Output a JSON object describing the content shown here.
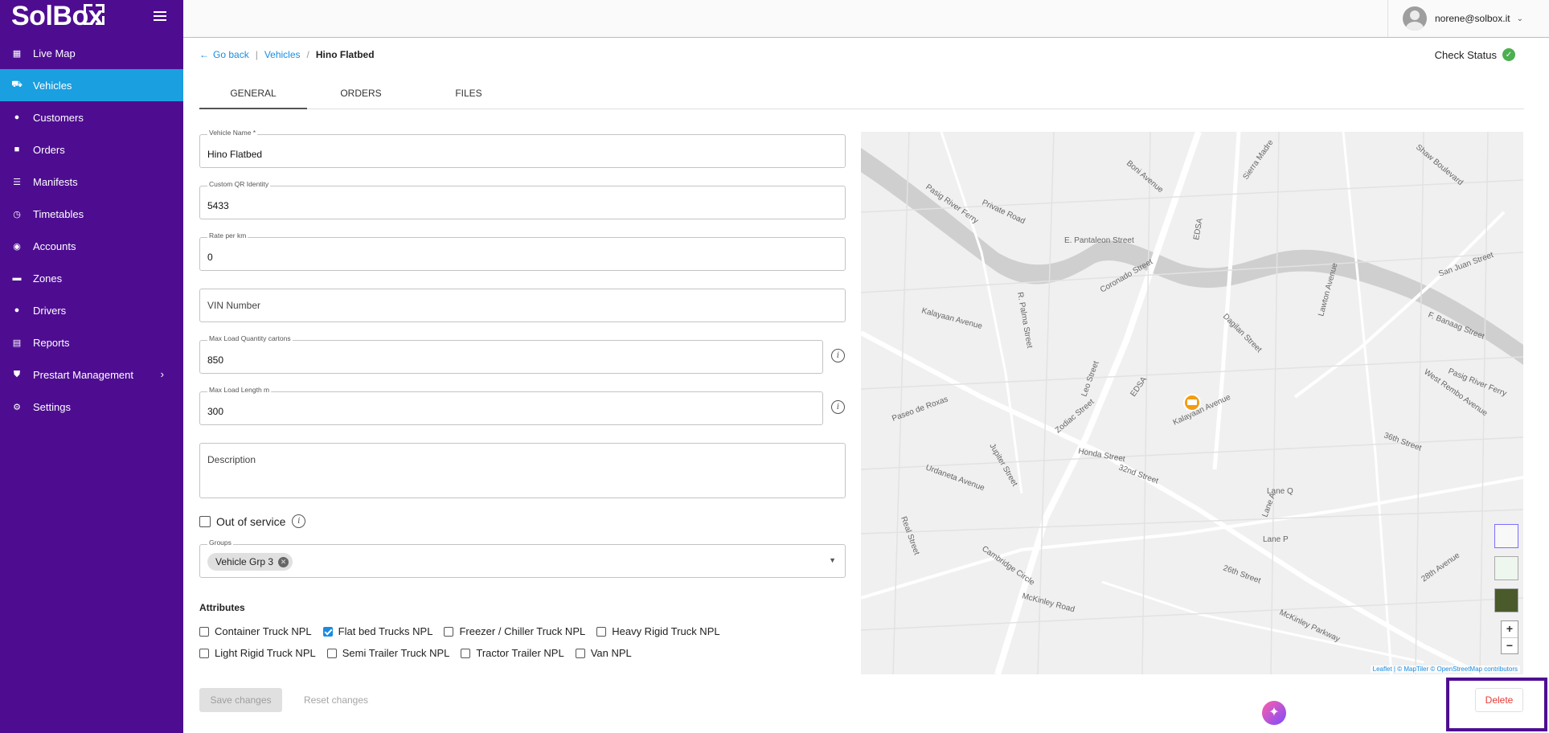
{
  "app": {
    "logo": "SolBox"
  },
  "sidebar": {
    "items": [
      {
        "label": "Live Map",
        "icon": "dashboard-icon"
      },
      {
        "label": "Vehicles",
        "icon": "truck-icon"
      },
      {
        "label": "Customers",
        "icon": "person-icon"
      },
      {
        "label": "Orders",
        "icon": "folder-icon"
      },
      {
        "label": "Manifests",
        "icon": "list-icon"
      },
      {
        "label": "Timetables",
        "icon": "clock-icon"
      },
      {
        "label": "Accounts",
        "icon": "account-icon"
      },
      {
        "label": "Zones",
        "icon": "zones-icon"
      },
      {
        "label": "Drivers",
        "icon": "person-icon"
      },
      {
        "label": "Reports",
        "icon": "report-icon"
      },
      {
        "label": "Prestart Management",
        "icon": "shield-icon"
      },
      {
        "label": "Settings",
        "icon": "gear-icon"
      }
    ],
    "active": "Vehicles"
  },
  "header": {
    "user_email": "norene@solbox.it"
  },
  "breadcrumb": {
    "back": "Go back",
    "sep1": "|",
    "parent": "Vehicles",
    "sep2": "/",
    "current": "Hino Flatbed"
  },
  "check_status": {
    "label": "Check Status"
  },
  "tabs": [
    {
      "label": "GENERAL"
    },
    {
      "label": "ORDERS"
    },
    {
      "label": "FILES"
    }
  ],
  "form": {
    "vehicle_name": {
      "label": "Vehicle Name *",
      "value": "Hino Flatbed"
    },
    "custom_qr": {
      "label": "Custom QR Identity",
      "value": "5433"
    },
    "rate_per_km": {
      "label": "Rate per km",
      "value": "0"
    },
    "vin": {
      "placeholder": "VIN Number"
    },
    "max_load_qty": {
      "label": "Max Load Quantity cartons",
      "value": "850"
    },
    "max_load_length": {
      "label": "Max Load Length m",
      "value": "300"
    },
    "description": {
      "placeholder": "Description"
    },
    "out_of_service": {
      "label": "Out of service",
      "checked": false
    },
    "groups": {
      "label": "Groups",
      "chip": "Vehicle Grp 3"
    }
  },
  "attributes": {
    "title": "Attributes",
    "row1": [
      {
        "label": "Container Truck NPL",
        "checked": false
      },
      {
        "label": "Flat bed Trucks NPL",
        "checked": true
      },
      {
        "label": "Freezer / Chiller Truck NPL",
        "checked": false
      },
      {
        "label": "Heavy Rigid Truck NPL",
        "checked": false
      }
    ],
    "row2": [
      {
        "label": "Light Rigid Truck NPL",
        "checked": false
      },
      {
        "label": "Semi Trailer Truck NPL",
        "checked": false
      },
      {
        "label": "Tractor Trailer NPL",
        "checked": false
      },
      {
        "label": "Van NPL",
        "checked": false
      }
    ]
  },
  "buttons": {
    "save": "Save changes",
    "reset": "Reset changes",
    "delete": "Delete"
  },
  "map": {
    "attribution_leaflet": "Leaflet",
    "attribution_rest": "| © MapTiler © OpenStreetMap contributors",
    "zoom_in": "+",
    "zoom_out": "−",
    "labels": [
      "Pasig River Ferry",
      "Pasig River Ferry",
      "E. Pantaleon Street",
      "Kalayaan Avenue",
      "Kalayaan Avenue",
      "Coronado Street",
      "EDSA",
      "EDSA",
      "Dagilan Street",
      "Leo Street",
      "Zodiac Street",
      "Jupiter Street",
      "Paseo de Roxas",
      "Honda Street",
      "32nd Street",
      "26th Street",
      "McKinley Road",
      "McKinley Parkway",
      "West Rembo Avenue",
      "36th Street",
      "Lawton Avenue",
      "Sierra Madre",
      "Boni Avenue",
      "Shaw Boulevard",
      "Cambridge Circle",
      "Lane A",
      "Lane P",
      "Lane Q",
      "28th Avenue",
      "Real Street",
      "Urdaneta Avenue",
      "San Juan Street",
      "F. Banaag Street",
      "Private Road",
      "R. Palma Street"
    ]
  },
  "colors": {
    "sidebar": "#4e0d91",
    "active": "#1a9fe0",
    "link": "#1a8ce0",
    "delete": "#e53935",
    "status_ok": "#4caf50"
  }
}
